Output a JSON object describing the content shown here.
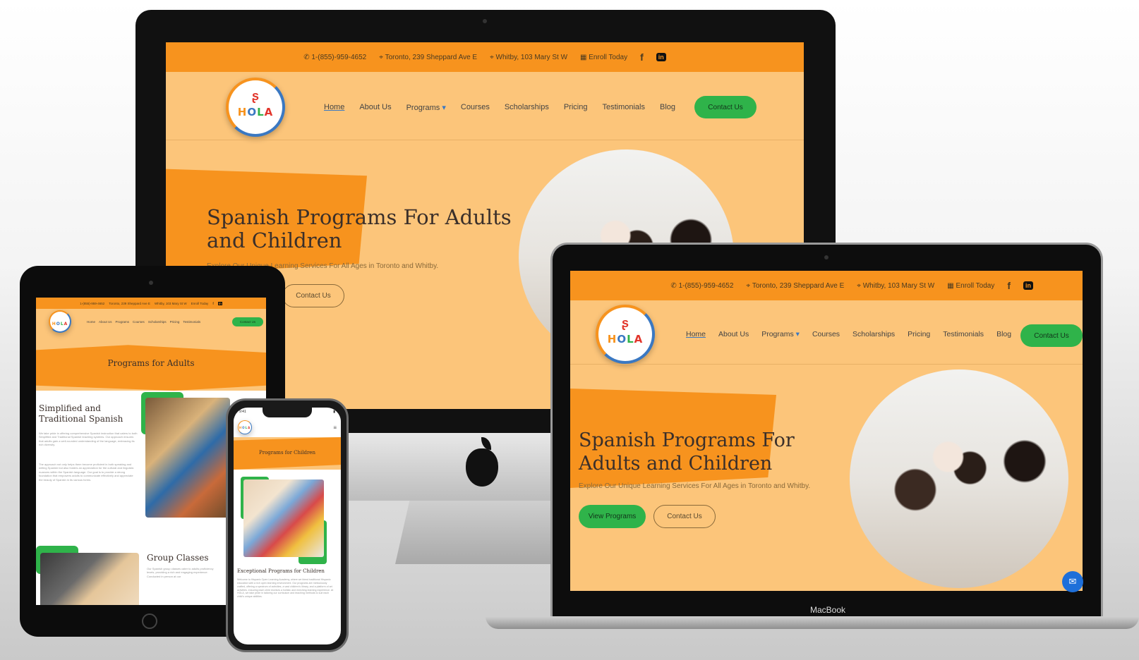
{
  "topbar": {
    "phone": "1-(855)-959-4652",
    "location1": "Toronto, 239 Sheppard Ave E",
    "location2": "Whitby, 103 Mary St W",
    "enroll": "Enroll Today"
  },
  "brand": {
    "logo_text": "HOLA"
  },
  "nav": {
    "items": [
      "Home",
      "About Us",
      "Programs",
      "Courses",
      "Scholarships",
      "Pricing",
      "Testimonials",
      "Blog"
    ],
    "contact": "Contact Us"
  },
  "hero": {
    "title": "Spanish Programs For Adults and Children",
    "subtitle": "Explore Our Unique Learning Services For All Ages in Toronto and Whitby.",
    "view_programs": "View Programs",
    "contact": "Contact Us"
  },
  "device": {
    "macbook_label": "MacBook"
  },
  "tablet": {
    "page_title": "Programs for Adults",
    "section1_title": "Simplified and Traditional Spanish",
    "section1_p1": "We take pride in offering comprehensive Spanish instruction that caters to both Simplified and Traditional Spanish teaching systems. Our approach ensures that adults gain a well-rounded understanding of the language, embracing its rich diversity.",
    "section1_p2": "The approach not only helps them become proficient in both speaking and writing Spanish but also fosters an appreciation for the cultural and linguistic nuances within the Spanish language. Our goal is to provide a strong foundation that empowers adults to communicate effectively and appreciate the beauty of Spanish in its various forms.",
    "section2_title": "Group Classes",
    "section2_p": "Our Spanish group classes cater to adults proficiency levels, providing a rich and engaging experience. Conducted in person at our"
  },
  "phone": {
    "time": "9:41",
    "page_title": "Programs for Children",
    "section_title": "Exceptional Programs for Children",
    "section_p": "Welcome to Hispanic Open Learning Academy, where we blend traditional Hispanic education with a rich open learning environment. Our programs are meticulously crafted, offering a spectrum of activities, a vast children's library, and a platform of art activities, ensuring each child receives a holistic and enriching learning experience. At HOLA, we take pride in tailoring our curriculum and teaching methods to suit each child's unique abilities."
  },
  "colors": {
    "orange": "#f7931e",
    "peach": "#fcc57a",
    "green": "#2fb34a",
    "blue": "#3a78c2"
  }
}
